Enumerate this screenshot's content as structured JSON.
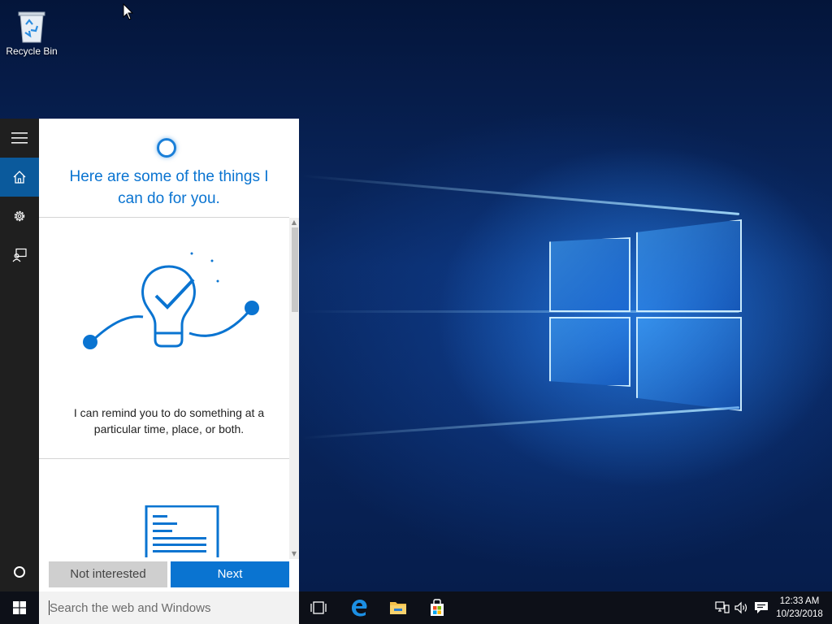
{
  "desktop": {
    "icons": [
      {
        "label": "Recycle Bin",
        "icon": "recycle-bin-icon"
      }
    ]
  },
  "cortana": {
    "rail": [
      {
        "name": "hamburger-menu",
        "icon": "hamburger-icon",
        "active": false
      },
      {
        "name": "home",
        "icon": "home-icon",
        "active": true
      },
      {
        "name": "settings",
        "icon": "gear-icon",
        "active": false
      },
      {
        "name": "feedback",
        "icon": "feedback-icon",
        "active": false
      },
      {
        "name": "cortana",
        "icon": "cortana-circle-icon",
        "active": false
      }
    ],
    "title": "Here are some of the things I can do for you.",
    "cards": [
      {
        "illustration": "lightbulb-checkmark-icon",
        "text": "I can remind you to do something at a particular time, place, or both."
      },
      {
        "illustration": "document-icon",
        "text": ""
      }
    ],
    "buttons": {
      "not_interested": "Not interested",
      "next": "Next"
    },
    "accent": "#0a74d1"
  },
  "taskbar": {
    "search_placeholder": "Search the web and Windows",
    "pinned": [
      {
        "name": "task-view",
        "icon": "task-view-icon"
      },
      {
        "name": "edge",
        "icon": "edge-icon"
      },
      {
        "name": "file-explorer",
        "icon": "folder-icon"
      },
      {
        "name": "store",
        "icon": "store-icon"
      }
    ],
    "tray": [
      "network-icon",
      "volume-icon",
      "action-center-icon"
    ],
    "clock": {
      "time": "12:33 AM",
      "date": "10/23/2018"
    }
  }
}
